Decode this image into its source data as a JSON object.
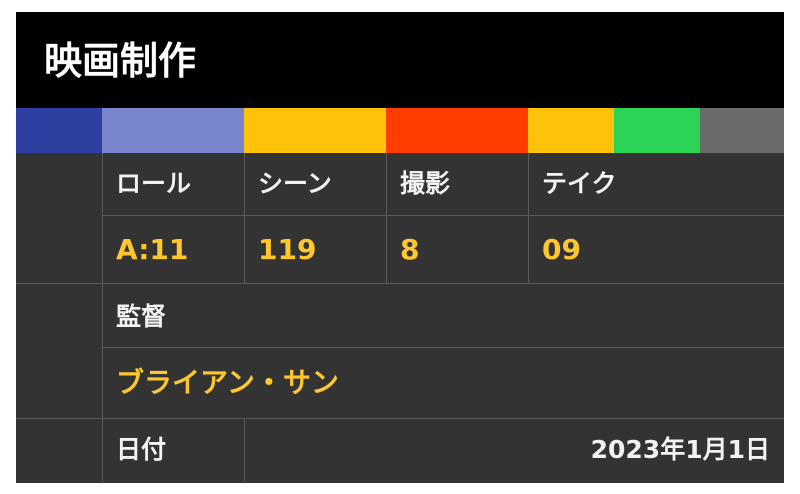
{
  "slate": {
    "title": "映画制作",
    "color_bars": [
      "#2e3da0",
      "#7884cc",
      "#ffc20a",
      "#ff3d00",
      "#ffc20a",
      "#2bd454",
      "#6b6b6b"
    ],
    "row1": {
      "labels": [
        "ロール",
        "シーン",
        "撮影",
        "テイク"
      ],
      "values": [
        "A:11",
        "119",
        "8",
        "09"
      ]
    },
    "director": {
      "label": "監督",
      "value": "ブライアン・サン"
    },
    "date": {
      "label": "日付",
      "value": "2023年1月1日"
    },
    "colors": {
      "background": "#333333",
      "header": "#000000",
      "value_text": "#ffc72c",
      "label_text": "#f2f2f2"
    }
  }
}
